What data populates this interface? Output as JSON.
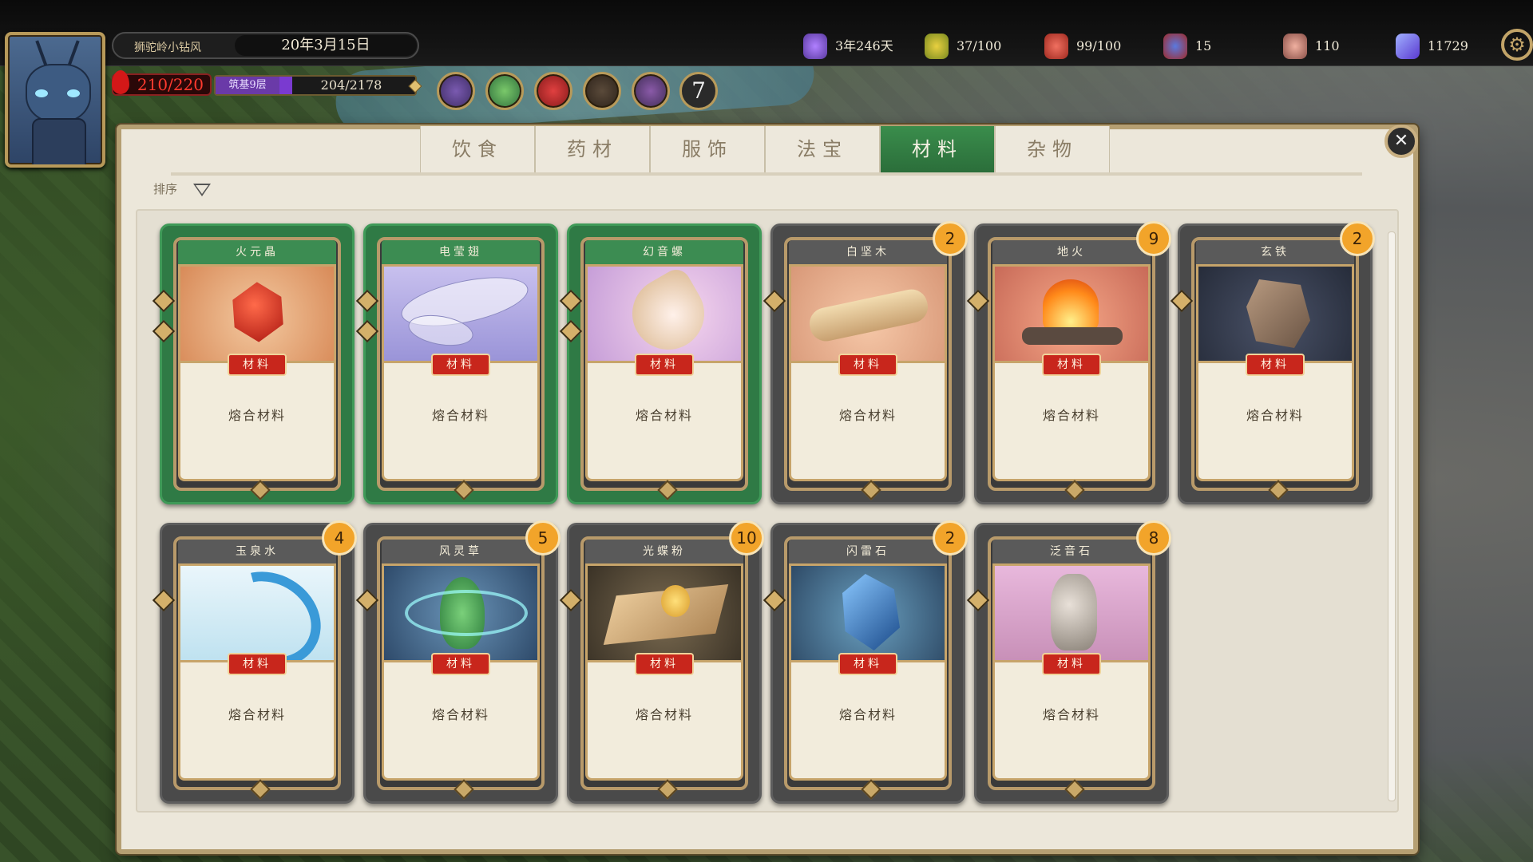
{
  "header": {
    "player_name": "狮驼岭小钻风",
    "date": "20年3月15日",
    "hp": "210/220",
    "cultivation_level": "筑基9层",
    "cultivation_exp": "204/2178",
    "cultivation_progress": 0.094,
    "buff_count": "7"
  },
  "resources": [
    {
      "icon": "incense-icon",
      "value": "3年246天"
    },
    {
      "icon": "disciple-icon",
      "value": "37/100"
    },
    {
      "icon": "meat-icon",
      "value": "99/100"
    },
    {
      "icon": "mask-icon",
      "value": "15"
    },
    {
      "icon": "prayer-hands-icon",
      "value": "110"
    },
    {
      "icon": "spirit-stone-icon",
      "value": "11729"
    }
  ],
  "tabs": [
    {
      "label": "饮食",
      "active": false
    },
    {
      "label": "药材",
      "active": false
    },
    {
      "label": "服饰",
      "active": false
    },
    {
      "label": "法宝",
      "active": false
    },
    {
      "label": "材料",
      "active": true
    },
    {
      "label": "杂物",
      "active": false
    }
  ],
  "sort_label": "排序",
  "items": [
    {
      "name": "火元晶",
      "tag": "材料",
      "desc": "熔合材料",
      "count": "",
      "style": "green"
    },
    {
      "name": "电莹翅",
      "tag": "材料",
      "desc": "熔合材料",
      "count": "",
      "style": "green"
    },
    {
      "name": "幻音螺",
      "tag": "材料",
      "desc": "熔合材料",
      "count": "",
      "style": "green"
    },
    {
      "name": "白坚木",
      "tag": "材料",
      "desc": "熔合材料",
      "count": "2",
      "style": "gray"
    },
    {
      "name": "地火",
      "tag": "材料",
      "desc": "熔合材料",
      "count": "9",
      "style": "gray"
    },
    {
      "name": "玄铁",
      "tag": "材料",
      "desc": "熔合材料",
      "count": "2",
      "style": "gray"
    },
    {
      "name": "玉泉水",
      "tag": "材料",
      "desc": "熔合材料",
      "count": "4",
      "style": "gray"
    },
    {
      "name": "风灵草",
      "tag": "材料",
      "desc": "熔合材料",
      "count": "5",
      "style": "gray"
    },
    {
      "name": "光蝶粉",
      "tag": "材料",
      "desc": "熔合材料",
      "count": "10",
      "style": "gray"
    },
    {
      "name": "闪雷石",
      "tag": "材料",
      "desc": "熔合材料",
      "count": "2",
      "style": "gray"
    },
    {
      "name": "泛音石",
      "tag": "材料",
      "desc": "熔合材料",
      "count": "8",
      "style": "gray"
    }
  ],
  "colors": {
    "active_tab": "#2f7a45",
    "tag_red": "#c8261c",
    "badge_orange": "#f2a42a",
    "hp_red": "#ff3a2e"
  }
}
